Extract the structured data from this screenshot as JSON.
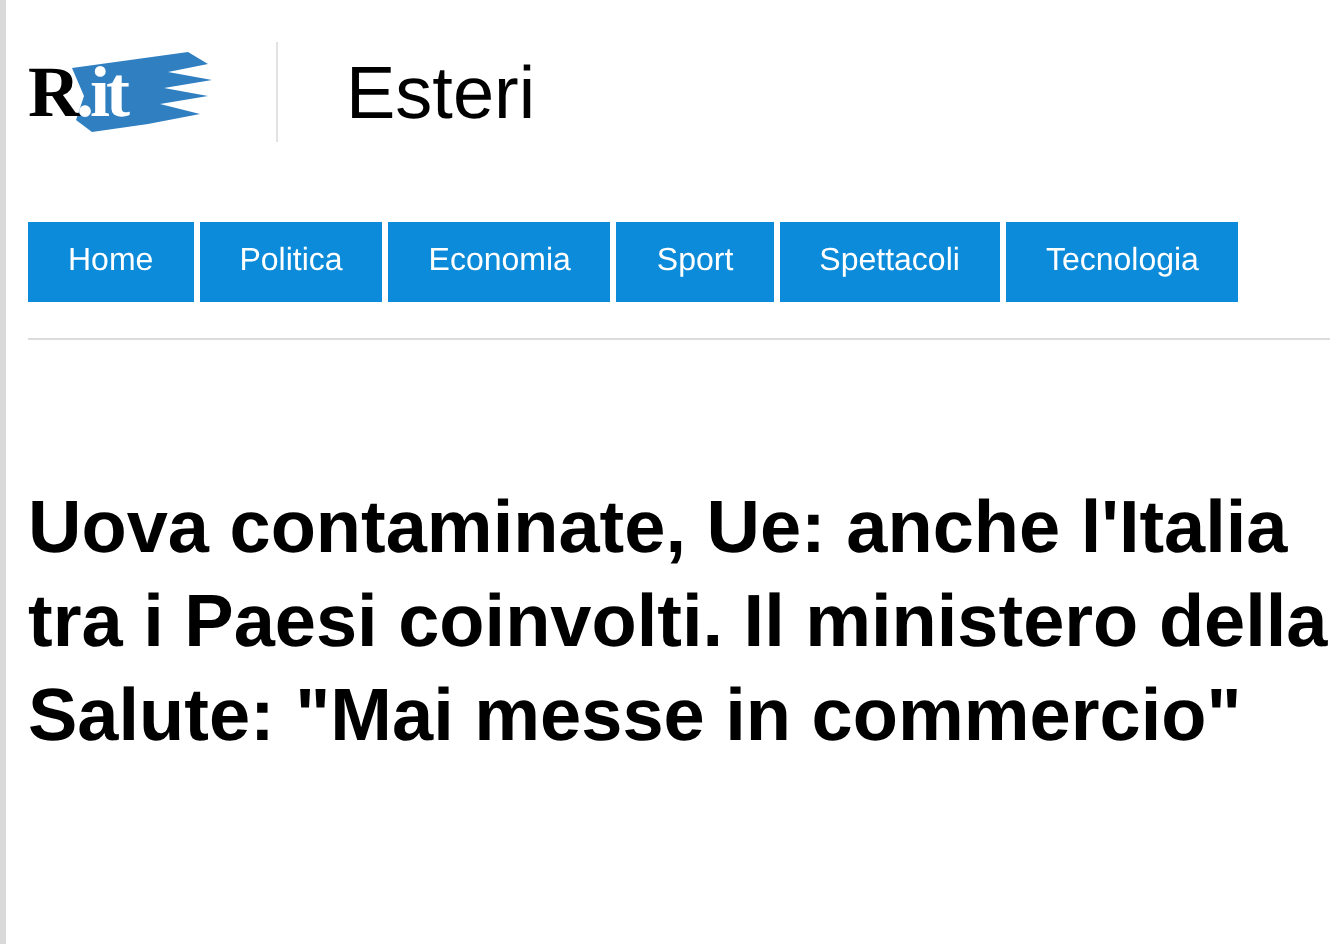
{
  "header": {
    "logo": "R.it",
    "section": "Esteri"
  },
  "nav": [
    {
      "label": "Home"
    },
    {
      "label": "Politica"
    },
    {
      "label": "Economia"
    },
    {
      "label": "Sport"
    },
    {
      "label": "Spettacoli"
    },
    {
      "label": "Tecnologia"
    }
  ],
  "article": {
    "headline": "Uova contaminate, Ue: anche l'Italia tra i Paesi coinvolti. Il ministero della Salute: \"Mai messe in commercio\""
  }
}
